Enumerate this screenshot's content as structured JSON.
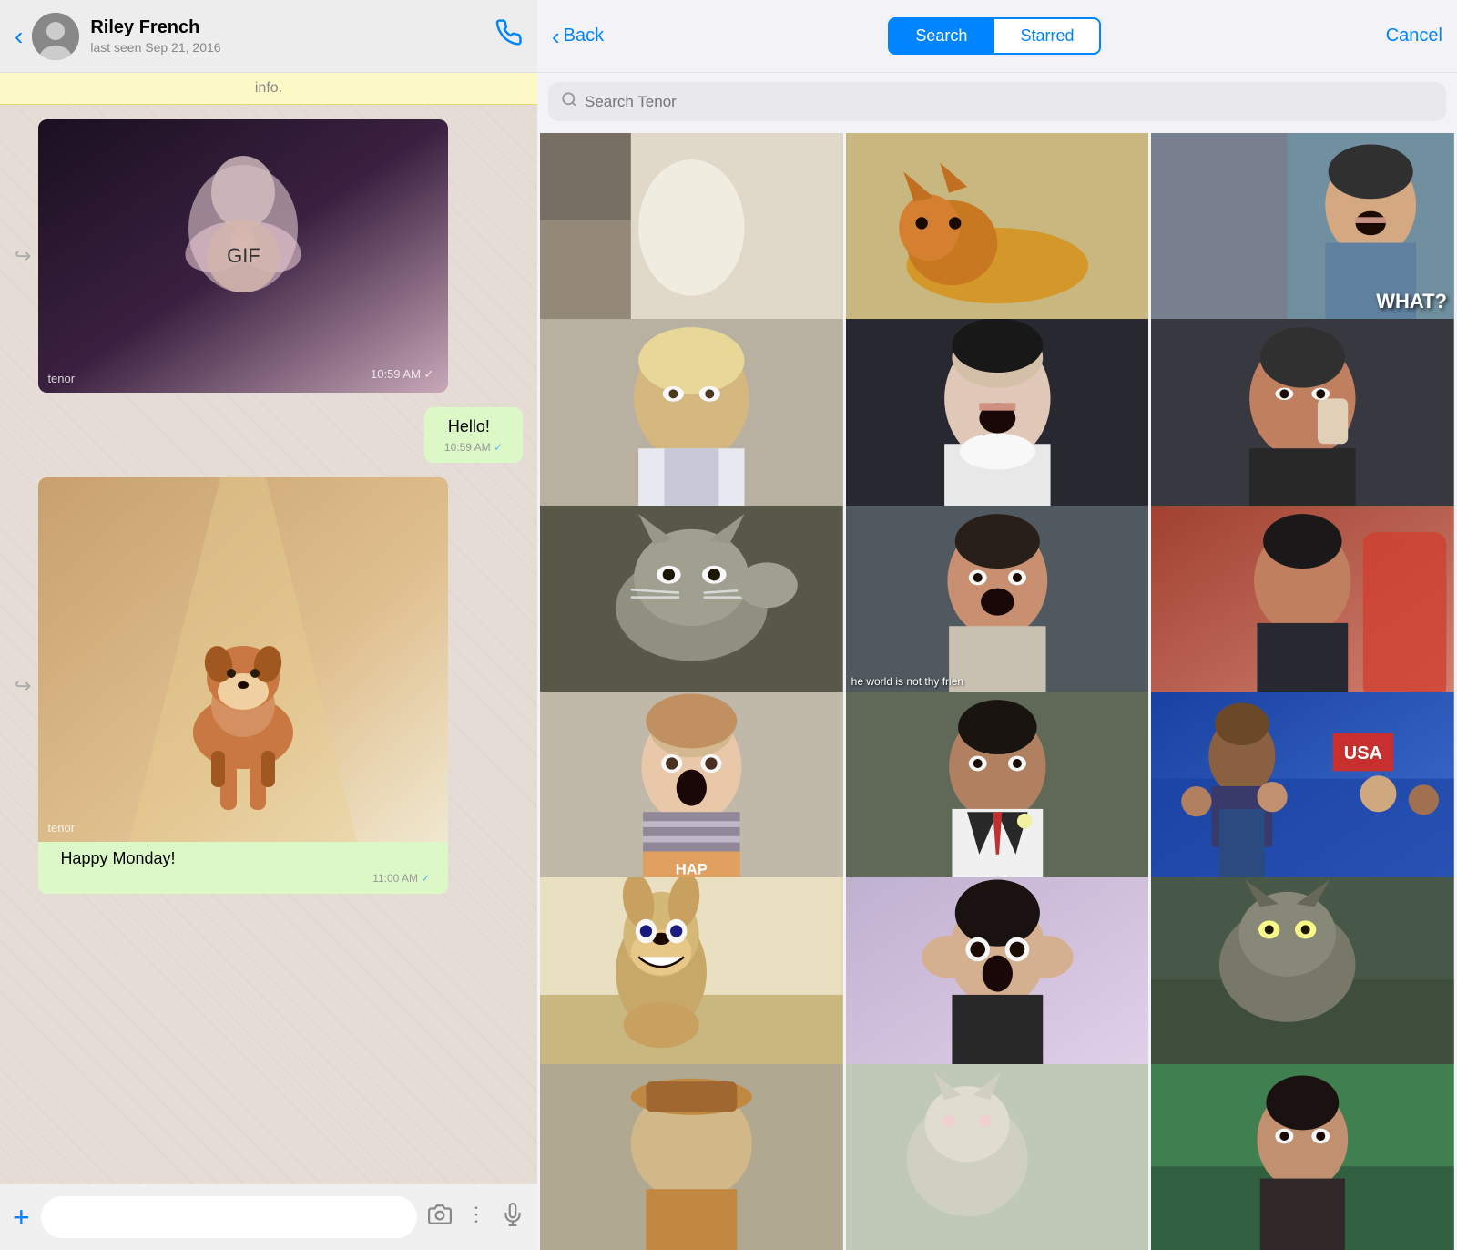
{
  "chat": {
    "back_label": "‹",
    "contact_name": "Riley French",
    "contact_status": "last seen Sep 21, 2016",
    "info_bar": "info.",
    "phone_icon": "📞",
    "messages": [
      {
        "id": "msg1",
        "type": "gif_received",
        "gif_label": "tenor",
        "gif_badge": "GIF",
        "time": "10:59 AM",
        "check": "✓"
      },
      {
        "id": "msg2",
        "type": "text_sent",
        "text": "Hello!",
        "time": "10:59 AM",
        "check": "✓"
      },
      {
        "id": "msg3",
        "type": "gif_received",
        "gif_label": "tenor",
        "caption": "Happy Monday!",
        "time": "11:00 AM",
        "check": "✓"
      }
    ],
    "footer": {
      "plus_icon": "+",
      "camera_icon": "📷",
      "menu_icon": "⋮",
      "mic_icon": "🎤",
      "input_placeholder": ""
    }
  },
  "gif_picker": {
    "back_label": "Back",
    "back_chevron": "‹",
    "tabs": [
      {
        "id": "search",
        "label": "Search",
        "active": true
      },
      {
        "id": "starred",
        "label": "Starred",
        "active": false
      }
    ],
    "cancel_label": "Cancel",
    "search_placeholder": "Search Tenor",
    "grid_items": [
      {
        "id": 1,
        "color_class": "gc-1",
        "label": "",
        "special": "none"
      },
      {
        "id": 2,
        "color_class": "gc-2",
        "label": "",
        "special": "none"
      },
      {
        "id": 3,
        "color_class": "gc-3",
        "label": "WHAT?",
        "special": "what"
      },
      {
        "id": 4,
        "color_class": "gc-4",
        "label": "",
        "special": "none"
      },
      {
        "id": 5,
        "color_class": "gc-5",
        "label": "",
        "special": "none"
      },
      {
        "id": 6,
        "color_class": "gc-6",
        "label": "",
        "special": "none"
      },
      {
        "id": 7,
        "color_class": "gc-7",
        "label": "",
        "special": "none"
      },
      {
        "id": 8,
        "color_class": "gc-8",
        "label": "he world is not thy frien",
        "special": "caption"
      },
      {
        "id": 9,
        "color_class": "gc-9",
        "label": "",
        "special": "none"
      },
      {
        "id": 10,
        "color_class": "gc-10",
        "label": "",
        "special": "none"
      },
      {
        "id": 11,
        "color_class": "gc-11",
        "label": "",
        "special": "none"
      },
      {
        "id": 12,
        "color_class": "gc-15",
        "label": "",
        "special": "none"
      },
      {
        "id": 13,
        "color_class": "gc-16",
        "label": "",
        "special": "none"
      },
      {
        "id": 14,
        "color_class": "gc-17",
        "label": "",
        "special": "none"
      },
      {
        "id": 15,
        "color_class": "gc-18",
        "label": "",
        "special": "none"
      },
      {
        "id": 16,
        "color_class": "gc-extra",
        "label": "",
        "special": "none"
      },
      {
        "id": 17,
        "color_class": "gc-extra",
        "label": "",
        "special": "none"
      },
      {
        "id": 18,
        "color_class": "gc-extra",
        "label": "",
        "special": "none"
      }
    ]
  }
}
